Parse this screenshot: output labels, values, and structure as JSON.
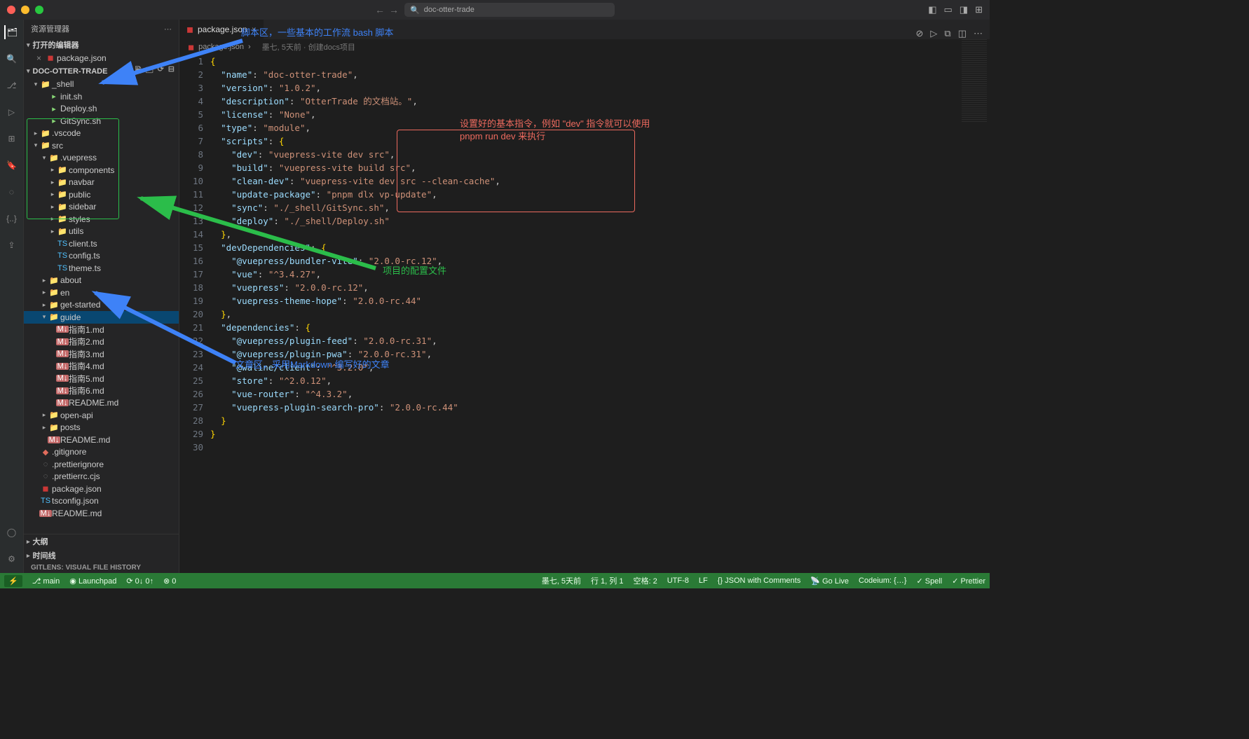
{
  "title_bar": {
    "search_placeholder": "doc-otter-trade"
  },
  "sidebar": {
    "title": "资源管理器",
    "open_editors_label": "打开的编辑器",
    "open_editors": [
      {
        "name": "package.json",
        "icon": "pkg"
      }
    ],
    "project_name": "DOC-OTTER-TRADE",
    "tree": [
      {
        "d": 0,
        "tw": "v",
        "icon": "folder",
        "name": "_shell"
      },
      {
        "d": 1,
        "tw": "",
        "icon": "sh",
        "name": "init.sh"
      },
      {
        "d": 1,
        "tw": "",
        "icon": "sh",
        "name": "Deploy.sh"
      },
      {
        "d": 1,
        "tw": "",
        "icon": "sh",
        "name": "GitSync.sh"
      },
      {
        "d": 0,
        "tw": ">",
        "icon": "folder",
        "name": ".vscode"
      },
      {
        "d": 0,
        "tw": "v",
        "icon": "folder",
        "name": "src"
      },
      {
        "d": 1,
        "tw": "v",
        "icon": "folder",
        "name": ".vuepress"
      },
      {
        "d": 2,
        "tw": ">",
        "icon": "folder",
        "name": "components"
      },
      {
        "d": 2,
        "tw": ">",
        "icon": "folder",
        "name": "navbar"
      },
      {
        "d": 2,
        "tw": ">",
        "icon": "folder",
        "name": "public"
      },
      {
        "d": 2,
        "tw": ">",
        "icon": "folder",
        "name": "sidebar"
      },
      {
        "d": 2,
        "tw": ">",
        "icon": "folder",
        "name": "styles"
      },
      {
        "d": 2,
        "tw": ">",
        "icon": "folder",
        "name": "utils"
      },
      {
        "d": 2,
        "tw": "",
        "icon": "ts",
        "name": "client.ts"
      },
      {
        "d": 2,
        "tw": "",
        "icon": "ts",
        "name": "config.ts"
      },
      {
        "d": 2,
        "tw": "",
        "icon": "ts",
        "name": "theme.ts"
      },
      {
        "d": 1,
        "tw": ">",
        "icon": "folder",
        "name": "about"
      },
      {
        "d": 1,
        "tw": ">",
        "icon": "folder",
        "name": "en"
      },
      {
        "d": 1,
        "tw": ">",
        "icon": "folder",
        "name": "get-started"
      },
      {
        "d": 1,
        "tw": "v",
        "icon": "folder",
        "name": "guide",
        "selected": true
      },
      {
        "d": 2,
        "tw": "",
        "icon": "md",
        "name": "指南1.md"
      },
      {
        "d": 2,
        "tw": "",
        "icon": "md",
        "name": "指南2.md"
      },
      {
        "d": 2,
        "tw": "",
        "icon": "md",
        "name": "指南3.md"
      },
      {
        "d": 2,
        "tw": "",
        "icon": "md",
        "name": "指南4.md"
      },
      {
        "d": 2,
        "tw": "",
        "icon": "md",
        "name": "指南5.md"
      },
      {
        "d": 2,
        "tw": "",
        "icon": "md",
        "name": "指南6.md"
      },
      {
        "d": 2,
        "tw": "",
        "icon": "md",
        "name": "README.md"
      },
      {
        "d": 1,
        "tw": ">",
        "icon": "folder",
        "name": "open-api"
      },
      {
        "d": 1,
        "tw": ">",
        "icon": "folder",
        "name": "posts"
      },
      {
        "d": 1,
        "tw": "",
        "icon": "md",
        "name": "README.md"
      },
      {
        "d": 0,
        "tw": "",
        "icon": "git",
        "name": ".gitignore"
      },
      {
        "d": 0,
        "tw": "",
        "icon": "grey",
        "name": ".prettierignore"
      },
      {
        "d": 0,
        "tw": "",
        "icon": "grey",
        "name": ".prettierrc.cjs"
      },
      {
        "d": 0,
        "tw": "",
        "icon": "pkg",
        "name": "package.json"
      },
      {
        "d": 0,
        "tw": "",
        "icon": "ts",
        "name": "tsconfig.json"
      },
      {
        "d": 0,
        "tw": "",
        "icon": "md",
        "name": "README.md"
      }
    ],
    "outline_label": "大纲",
    "timeline_label": "时间线",
    "gitlens_label": "GITLENS: VISUAL FILE HISTORY"
  },
  "editor": {
    "tab_name": "package.json",
    "breadcrumb": "package.json",
    "breadcrumb_git": "墨七, 5天前 · 创建docs项目",
    "code_lines": [
      [
        [
          "brace",
          "{"
        ]
      ],
      [
        [
          "punc",
          "  "
        ],
        [
          "key",
          "\"name\""
        ],
        [
          "punc",
          ": "
        ],
        [
          "str",
          "\"doc-otter-trade\""
        ],
        [
          "punc",
          ","
        ]
      ],
      [
        [
          "punc",
          "  "
        ],
        [
          "key",
          "\"version\""
        ],
        [
          "punc",
          ": "
        ],
        [
          "str",
          "\"1.0.2\""
        ],
        [
          "punc",
          ","
        ]
      ],
      [
        [
          "punc",
          "  "
        ],
        [
          "key",
          "\"description\""
        ],
        [
          "punc",
          ": "
        ],
        [
          "str",
          "\"OtterTrade 的文档站。\""
        ],
        [
          "punc",
          ","
        ]
      ],
      [
        [
          "punc",
          "  "
        ],
        [
          "key",
          "\"license\""
        ],
        [
          "punc",
          ": "
        ],
        [
          "str",
          "\"None\""
        ],
        [
          "punc",
          ","
        ]
      ],
      [
        [
          "punc",
          "  "
        ],
        [
          "key",
          "\"type\""
        ],
        [
          "punc",
          ": "
        ],
        [
          "str",
          "\"module\""
        ],
        [
          "punc",
          ","
        ]
      ],
      [
        [
          "punc",
          "  "
        ],
        [
          "key",
          "\"scripts\""
        ],
        [
          "punc",
          ": "
        ],
        [
          "brace",
          "{"
        ]
      ],
      [
        [
          "punc",
          "    "
        ],
        [
          "key",
          "\"dev\""
        ],
        [
          "punc",
          ": "
        ],
        [
          "str",
          "\"vuepress-vite dev src\""
        ],
        [
          "punc",
          ","
        ]
      ],
      [
        [
          "punc",
          "    "
        ],
        [
          "key",
          "\"build\""
        ],
        [
          "punc",
          ": "
        ],
        [
          "str",
          "\"vuepress-vite build src\""
        ],
        [
          "punc",
          ","
        ]
      ],
      [
        [
          "punc",
          "    "
        ],
        [
          "key",
          "\"clean-dev\""
        ],
        [
          "punc",
          ": "
        ],
        [
          "str",
          "\"vuepress-vite dev src --clean-cache\""
        ],
        [
          "punc",
          ","
        ]
      ],
      [
        [
          "punc",
          "    "
        ],
        [
          "key",
          "\"update-package\""
        ],
        [
          "punc",
          ": "
        ],
        [
          "str",
          "\"pnpm dlx vp-update\""
        ],
        [
          "punc",
          ","
        ]
      ],
      [
        [
          "punc",
          "    "
        ],
        [
          "key",
          "\"sync\""
        ],
        [
          "punc",
          ": "
        ],
        [
          "str",
          "\"./_shell/GitSync.sh\""
        ],
        [
          "punc",
          ","
        ]
      ],
      [
        [
          "punc",
          "    "
        ],
        [
          "key",
          "\"deploy\""
        ],
        [
          "punc",
          ": "
        ],
        [
          "str",
          "\"./_shell/Deploy.sh\""
        ]
      ],
      [
        [
          "punc",
          "  "
        ],
        [
          "brace",
          "}"
        ],
        [
          "punc",
          ","
        ]
      ],
      [
        [
          "punc",
          "  "
        ],
        [
          "key",
          "\"devDependencies\""
        ],
        [
          "punc",
          ": "
        ],
        [
          "brace",
          "{"
        ]
      ],
      [
        [
          "punc",
          "    "
        ],
        [
          "key",
          "\"@vuepress/bundler-vite\""
        ],
        [
          "punc",
          ": "
        ],
        [
          "str",
          "\"2.0.0-rc.12\""
        ],
        [
          "punc",
          ","
        ]
      ],
      [
        [
          "punc",
          "    "
        ],
        [
          "key",
          "\"vue\""
        ],
        [
          "punc",
          ": "
        ],
        [
          "str",
          "\"^3.4.27\""
        ],
        [
          "punc",
          ","
        ]
      ],
      [
        [
          "punc",
          "    "
        ],
        [
          "key",
          "\"vuepress\""
        ],
        [
          "punc",
          ": "
        ],
        [
          "str",
          "\"2.0.0-rc.12\""
        ],
        [
          "punc",
          ","
        ]
      ],
      [
        [
          "punc",
          "    "
        ],
        [
          "key",
          "\"vuepress-theme-hope\""
        ],
        [
          "punc",
          ": "
        ],
        [
          "str",
          "\"2.0.0-rc.44\""
        ]
      ],
      [
        [
          "punc",
          "  "
        ],
        [
          "brace",
          "}"
        ],
        [
          "punc",
          ","
        ]
      ],
      [
        [
          "punc",
          "  "
        ],
        [
          "key",
          "\"dependencies\""
        ],
        [
          "punc",
          ": "
        ],
        [
          "brace",
          "{"
        ]
      ],
      [
        [
          "punc",
          "    "
        ],
        [
          "key",
          "\"@vuepress/plugin-feed\""
        ],
        [
          "punc",
          ": "
        ],
        [
          "str",
          "\"2.0.0-rc.31\""
        ],
        [
          "punc",
          ","
        ]
      ],
      [
        [
          "punc",
          "    "
        ],
        [
          "key",
          "\"@vuepress/plugin-pwa\""
        ],
        [
          "punc",
          ": "
        ],
        [
          "str",
          "\"2.0.0-rc.31\""
        ],
        [
          "punc",
          ","
        ]
      ],
      [
        [
          "punc",
          "    "
        ],
        [
          "key",
          "\"@waline/client\""
        ],
        [
          "punc",
          ": "
        ],
        [
          "str",
          "\"^3.2.0\""
        ],
        [
          "punc",
          ","
        ]
      ],
      [
        [
          "punc",
          "    "
        ],
        [
          "key",
          "\"store\""
        ],
        [
          "punc",
          ": "
        ],
        [
          "str",
          "\"^2.0.12\""
        ],
        [
          "punc",
          ","
        ]
      ],
      [
        [
          "punc",
          "    "
        ],
        [
          "key",
          "\"vue-router\""
        ],
        [
          "punc",
          ": "
        ],
        [
          "str",
          "\"^4.3.2\""
        ],
        [
          "punc",
          ","
        ]
      ],
      [
        [
          "punc",
          "    "
        ],
        [
          "key",
          "\"vuepress-plugin-search-pro\""
        ],
        [
          "punc",
          ": "
        ],
        [
          "str",
          "\"2.0.0-rc.44\""
        ]
      ],
      [
        [
          "punc",
          "  "
        ],
        [
          "brace",
          "}"
        ]
      ],
      [
        [
          "brace",
          "}"
        ]
      ],
      []
    ]
  },
  "status_bar": {
    "left": {
      "branch": "main",
      "launchpad": "Launchpad",
      "sync": "0↓ 0↑",
      "problems": "0"
    },
    "right": {
      "blame": "墨七, 5天前",
      "cursor": "行 1, 列 1",
      "spaces": "空格: 2",
      "encoding": "UTF-8",
      "eol": "LF",
      "lang": "JSON with Comments",
      "golive": "Go Live",
      "codeium": "Codeium: {…}",
      "spell": "Spell",
      "prettier": "Prettier"
    }
  },
  "annotations": {
    "top_blue": "脚本区，一些基本的工作流 bash 脚本",
    "red_line1": "设置好的基本指令，例如 \"dev\" 指令就可以使用",
    "red_line2": "pnpm run dev 来执行",
    "green_text": "项目的配置文件",
    "bottom_blue": "文章区，采用Markdown 编写好的文章"
  }
}
